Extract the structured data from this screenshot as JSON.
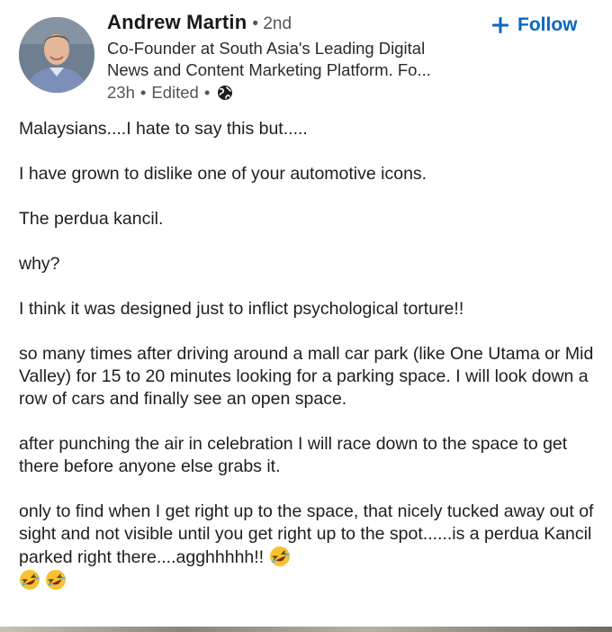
{
  "author": {
    "name": "Andrew Martin",
    "degree": "• 2nd",
    "headline": "Co-Founder at South Asia's Leading Digital\nNews and Content Marketing Platform. Fo...",
    "time": "23h",
    "sep1": "•",
    "edited": "Edited",
    "sep2": "•"
  },
  "follow": {
    "label": "Follow",
    "color": "#0a66c2"
  },
  "post": {
    "p1": "Malaysians....I hate to say this but.....",
    "p2": "I have grown to dislike one of your automotive icons.",
    "p3": "The perdua kancil.",
    "p4": "why?",
    "p5": "I think it was designed just to inflict psychological torture!!",
    "p6": "so many times after driving around a mall car park (like One Utama or Mid Valley) for 15 to 20 minutes looking for a parking space. I will look down a row of cars and finally see an open space.",
    "p7": "after punching the air in celebration I will race down to the space to get there before anyone else grabs it.",
    "p8": "only to find when I get right up to the space, that nicely tucked away out of sight and not visible until you get right up to the spot......is a perdua Kancil parked right there....agghhhhh!!",
    "emoji_icon": "rolling-on-floor-laughing-emoji"
  }
}
